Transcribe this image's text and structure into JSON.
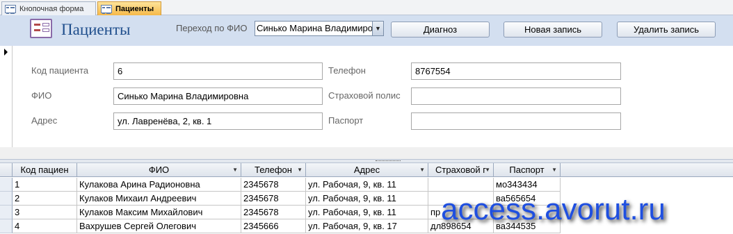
{
  "tabs": [
    {
      "label": "Кнопочная форма",
      "active": false
    },
    {
      "label": "Пациенты",
      "active": true
    }
  ],
  "header": {
    "title": "Пациенты",
    "nav_label": "Переход по ФИО",
    "nav_value": "Синько Марина Владимировна",
    "buttons": {
      "diagnosis": "Диагноз",
      "new_record": "Новая запись",
      "delete_record": "Удалить запись"
    }
  },
  "form": {
    "patient_code": {
      "label": "Код пациента",
      "value": "6"
    },
    "fio": {
      "label": "ФИО",
      "value": "Синько Марина Владимировна"
    },
    "address": {
      "label": "Адрес",
      "value": "ул. Лавренёва, 2, кв. 1"
    },
    "phone": {
      "label": "Телефон",
      "value": "8767554"
    },
    "insurance": {
      "label": "Страховой полис",
      "value": ""
    },
    "passport": {
      "label": "Паспорт",
      "value": ""
    }
  },
  "grid": {
    "columns": [
      "Код пациен",
      "ФИО",
      "Телефон",
      "Адрес",
      "Страховой г",
      "Паспорт"
    ],
    "rows": [
      [
        "1",
        "Кулакова Арина Радионовна",
        "2345678",
        "ул. Рабочая, 9, кв. 11",
        "",
        "мо343434"
      ],
      [
        "2",
        "Кулаков Михаил Андреевич",
        "2345678",
        "ул. Рабочая, 9, кв. 11",
        "",
        "ва565654"
      ],
      [
        "3",
        "Кулаков Максим Михайлович",
        "2345678",
        "ул. Рабочая, 9, кв. 11",
        "пр",
        ""
      ],
      [
        "4",
        "Вахрушев Сергей Олегович",
        "2345666",
        "ул. Рабочая, 9, кв. 17",
        "дл898654",
        "ва344535"
      ]
    ]
  },
  "watermark": "access.avorut.ru",
  "colors": {
    "accent": "#1f4e8c",
    "header_bg": "#d3dff0",
    "active_tab": "#f6b949",
    "watermark": "#1f4fe0"
  }
}
